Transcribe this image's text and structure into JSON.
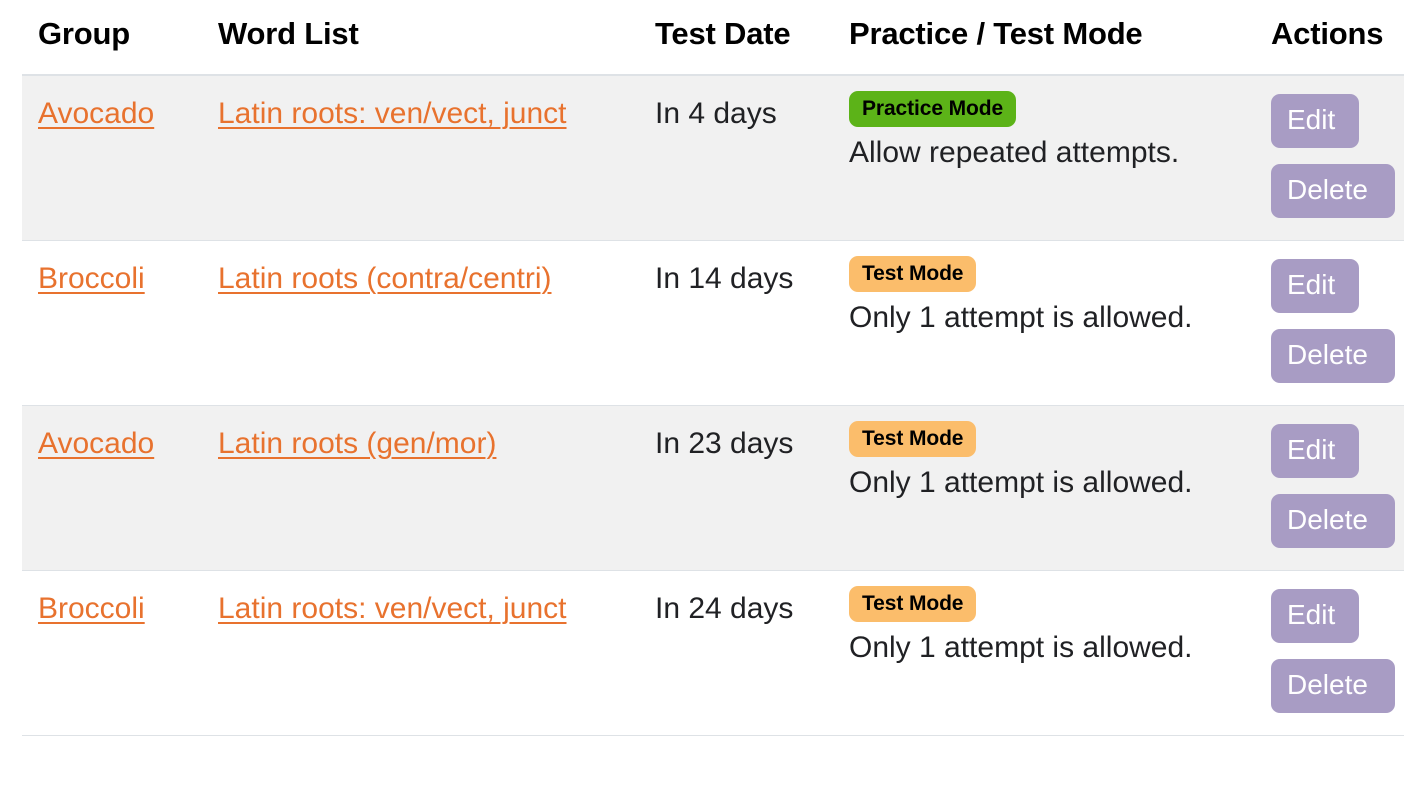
{
  "table": {
    "columns": [
      {
        "key": "group",
        "label": "Group"
      },
      {
        "key": "wordlist",
        "label": "Word List"
      },
      {
        "key": "testdate",
        "label": "Test Date"
      },
      {
        "key": "mode",
        "label": "Practice / Test Mode"
      },
      {
        "key": "actions",
        "label": "Actions"
      }
    ],
    "rows": [
      {
        "group": "Avocado",
        "wordlist": "Latin roots: ven/vect, junct",
        "testdate": "In 4 days",
        "mode_badge": "Practice Mode",
        "mode_type": "practice",
        "mode_desc": "Allow repeated attempts.",
        "edit_label": "Edit",
        "delete_label": "Delete"
      },
      {
        "group": "Broccoli",
        "wordlist": "Latin roots (contra/centri)",
        "testdate": "In 14 days",
        "mode_badge": "Test Mode",
        "mode_type": "test",
        "mode_desc": "Only 1 attempt is allowed.",
        "edit_label": "Edit",
        "delete_label": "Delete"
      },
      {
        "group": "Avocado",
        "wordlist": "Latin roots (gen/mor)",
        "testdate": "In 23 days",
        "mode_badge": "Test Mode",
        "mode_type": "test",
        "mode_desc": "Only 1 attempt is allowed.",
        "edit_label": "Edit",
        "delete_label": "Delete"
      },
      {
        "group": "Broccoli",
        "wordlist": "Latin roots: ven/vect, junct",
        "testdate": "In 24 days",
        "mode_badge": "Test Mode",
        "mode_type": "test",
        "mode_desc": "Only 1 attempt is allowed.",
        "edit_label": "Edit",
        "delete_label": "Delete"
      }
    ]
  },
  "colors": {
    "link": "#e8722e",
    "practice_badge": "#5cb318",
    "test_badge": "#fbbd6b",
    "action_button": "#a89cc4",
    "row_stripe": "#f1f1f1",
    "row_border": "#dee2e6"
  }
}
